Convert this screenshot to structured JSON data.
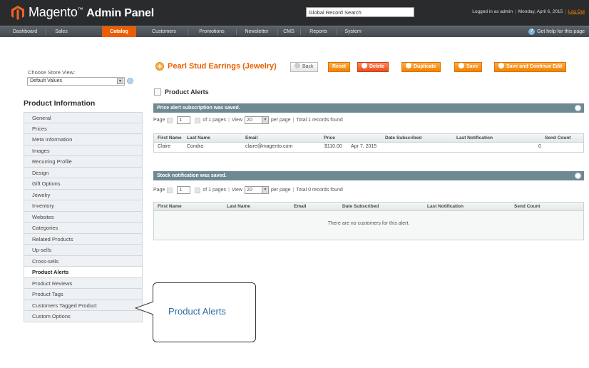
{
  "header": {
    "logo_brand": "Magento",
    "logo_suffix": "Admin Panel",
    "search_value": "Global Record Search",
    "logged_in": "Logged in as admin",
    "date": "Monday, April 6, 2015",
    "logout": "Log Out"
  },
  "nav": {
    "items": [
      "Dashboard",
      "Sales",
      "Catalog",
      "Customers",
      "Promotions",
      "Newsletter",
      "CMS",
      "Reports",
      "System"
    ],
    "active": "Catalog",
    "help": "Get help for this page"
  },
  "sidebar": {
    "store_label": "Choose Store View:",
    "store_value": "Default Values",
    "title": "Product Information",
    "items": [
      "General",
      "Prices",
      "Meta Information",
      "Images",
      "Recurring Profile",
      "Design",
      "Gift Options",
      "Jewelry",
      "Inventory",
      "Websites",
      "Categories",
      "Related Products",
      "Up-sells",
      "Cross-sells",
      "Product Alerts",
      "Product Reviews",
      "Product Tags",
      "Customers Tagged Product",
      "Custom Options"
    ],
    "active": "Product Alerts"
  },
  "page": {
    "title": "Pearl Stud Earrings (Jewelry)",
    "buttons": {
      "back": "Back",
      "reset": "Reset",
      "delete": "Delete",
      "duplicate": "Duplicate",
      "save": "Save",
      "save_continue": "Save and Continue Edit"
    },
    "section_title": "Product Alerts"
  },
  "price_alerts": {
    "message": "Price alert subscription was saved.",
    "pager": {
      "page_label": "Page",
      "page_value": "1",
      "of_pages": "of 1 pages",
      "view_label": "View",
      "view_value": "20",
      "per_page": "per page",
      "total": "Total 1 records found"
    },
    "columns": [
      "First Name",
      "Last Name",
      "Email",
      "Price",
      "Date Subscribed",
      "Last Notification",
      "Send Count"
    ],
    "rows": [
      [
        "Claire",
        "Condra",
        "claire@magento.com",
        "$110.00",
        "Apr 7, 2015",
        "",
        "0"
      ]
    ]
  },
  "stock_alerts": {
    "message": "Stock notification was saved.",
    "pager": {
      "page_label": "Page",
      "page_value": "1",
      "of_pages": "of 1 pages",
      "view_label": "View",
      "view_value": "20",
      "per_page": "per page",
      "total": "Total 0 records found"
    },
    "columns": [
      "First Name",
      "Last Name",
      "Email",
      "Date Subscribed",
      "Last Notification",
      "Send Count"
    ],
    "empty": "There are no customers for this alert."
  },
  "callout": {
    "text": "Product Alerts"
  },
  "colors": {
    "accent": "#eb5e00",
    "header_bg": "#2a2b2d",
    "message_bar": "#6f8992",
    "callout_text": "#2e6da4"
  }
}
